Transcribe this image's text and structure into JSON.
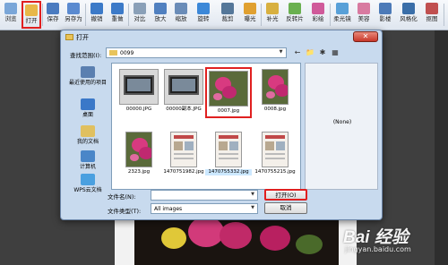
{
  "toolbar": {
    "items": [
      {
        "label": "浏览",
        "icon": "browse-icon",
        "color": "#7aa6d8"
      },
      {
        "label": "打开",
        "icon": "open-folder-icon",
        "color": "#e8b848",
        "active": true
      },
      {
        "label": "保存",
        "icon": "save-icon",
        "color": "#4a7bc0"
      },
      {
        "label": "另存为",
        "icon": "save-as-icon",
        "color": "#5a8ad0"
      },
      {
        "label": "撤销",
        "icon": "undo-icon",
        "color": "#3c7ac8"
      },
      {
        "label": "重做",
        "icon": "redo-icon",
        "color": "#3c7ac8"
      },
      {
        "label": "对比",
        "icon": "compare-icon",
        "color": "#8aa0b8"
      },
      {
        "label": "放大",
        "icon": "zoom-in-icon",
        "color": "#5080c0"
      },
      {
        "label": "缩放",
        "icon": "resize-icon",
        "color": "#6a8cb8"
      },
      {
        "label": "旋转",
        "icon": "rotate-icon",
        "color": "#3c88d8"
      },
      {
        "label": "裁剪",
        "icon": "crop-icon",
        "color": "#557799"
      },
      {
        "label": "曝光",
        "icon": "exposure-icon",
        "color": "#e0a030"
      },
      {
        "label": "补光",
        "icon": "fill-light-icon",
        "color": "#d8b040"
      },
      {
        "label": "反转片",
        "icon": "film-icon",
        "color": "#6ab050"
      },
      {
        "label": "彩绘",
        "icon": "paint-icon",
        "color": "#d05a9a"
      },
      {
        "label": "柔光镜",
        "icon": "soft-light-icon",
        "color": "#58a0d8"
      },
      {
        "label": "美容",
        "icon": "beauty-icon",
        "color": "#d87aa0"
      },
      {
        "label": "影楼",
        "icon": "studio-icon",
        "color": "#4c7ab8"
      },
      {
        "label": "风格化",
        "icon": "stylize-icon",
        "color": "#3a6ea8"
      },
      {
        "label": "抠图",
        "icon": "cutout-icon",
        "color": "#c05050"
      },
      {
        "label": "日历",
        "icon": "calendar-icon",
        "color": "#d04040"
      }
    ]
  },
  "dialog": {
    "title": "打开",
    "close_symbol": "✕",
    "look_in_label": "查找范围(I):",
    "look_in_value": "0099",
    "nav": [
      "←",
      "📁",
      "✱",
      "▦"
    ],
    "places": [
      {
        "label": "最近使用的项目",
        "icon": "recent-places-icon",
        "color": "#5a7fb0"
      },
      {
        "label": "桌面",
        "icon": "desktop-icon",
        "color": "#3a78c8"
      },
      {
        "label": "我的文档",
        "icon": "my-documents-icon",
        "color": "#e0c060"
      },
      {
        "label": "计算机",
        "icon": "computer-icon",
        "color": "#4a86c8"
      },
      {
        "label": "WPS云文档",
        "icon": "cloud-docs-icon",
        "color": "#4aa0e0"
      }
    ],
    "files": [
      {
        "name": "00000.JPG",
        "kind": "monitor"
      },
      {
        "name": "00000副本.JPG",
        "kind": "monitor"
      },
      {
        "name": "0007.jpg",
        "kind": "flower",
        "highlight": true
      },
      {
        "name": "0008.jpg",
        "kind": "flower-tall"
      },
      {
        "name": "2323.jpg",
        "kind": "flower-tall"
      },
      {
        "name": "1470751982.jpg",
        "kind": "doc"
      },
      {
        "name": "1470755332.jpg",
        "kind": "doc",
        "selected": true
      },
      {
        "name": "1470755215.jpg",
        "kind": "doc"
      }
    ],
    "preview_text": "(None)",
    "file_name_label": "文件名(N):",
    "file_name_value": "",
    "file_type_label": "文件类型(T):",
    "file_type_value": "All images",
    "open_button": "打开(O)",
    "cancel_button": "取消"
  },
  "watermark": {
    "logo": "Bai 经验",
    "sub": "jingyan.baidu.com"
  }
}
